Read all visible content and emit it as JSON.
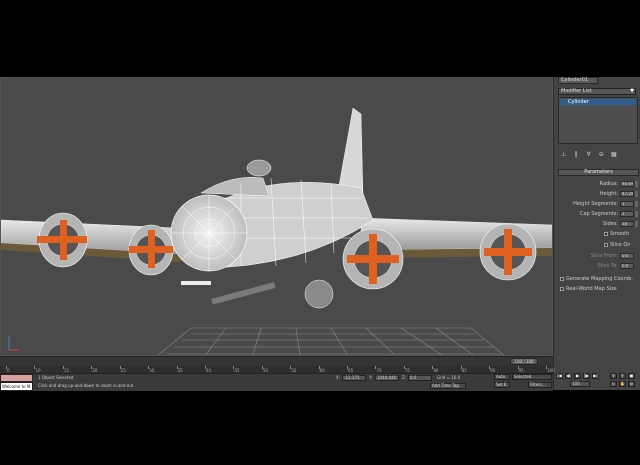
{
  "command_panel": {
    "object_name": "Cylinder01",
    "modifier_list": "Modifier List",
    "modifier_stack": [
      "Cylinder"
    ],
    "tool_icons": [
      "pin-stack-icon",
      "show-end-result-icon",
      "make-unique-icon",
      "remove-modifier-icon",
      "configure-sets-icon"
    ],
    "rollout_title": "Parameters",
    "params": [
      {
        "label": "Radius:",
        "value": "46.698"
      },
      {
        "label": "Height:",
        "value": "47.299"
      },
      {
        "label": "Height Segments:",
        "value": "1"
      },
      {
        "label": "Cap Segments:",
        "value": "1"
      },
      {
        "label": "Sides:",
        "value": "18"
      }
    ],
    "smooth_label": "Smooth",
    "slice_on_label": "Slice On",
    "slice_from_label": "Slice From:",
    "slice_from_value": "0.0",
    "slice_to_label": "Slice To:",
    "slice_to_value": "0.0",
    "gen_mapping_label": "Generate Mapping Coords.",
    "real_world_label": "Real-World Map Size"
  },
  "timeline": {
    "frame_counter": "100 / 100",
    "ruler_labels": [
      "0",
      "10",
      "15",
      "20",
      "25",
      "30",
      "35",
      "40",
      "45",
      "50",
      "55",
      "60",
      "65",
      "70",
      "75",
      "80",
      "85",
      "90",
      "95",
      "100"
    ]
  },
  "status": {
    "maxscript_label": "Welcome to M",
    "selection_text": "1 Object Selected",
    "prompt_text": "Click and drag up-and-down to zoom in and out",
    "x_label": "X:",
    "x_value": "-11.175",
    "y_label": "Y:",
    "y_value": "1040.440",
    "z_label": "Z:",
    "z_value": "0.0",
    "grid_text": "Grid = 10.0",
    "add_time_tag": "Add Time Tag",
    "auto_key": "Auto",
    "set_key": "Set K",
    "selected_dropdown": "Selected",
    "filters": "Filters...",
    "frame_value": "100",
    "playback_icons": [
      "go-start-icon",
      "prev-frame-icon",
      "play-icon",
      "next-frame-icon",
      "go-end-icon"
    ]
  },
  "colors": {
    "viewport_bg": "#4a4a4a",
    "wire": "#f2f2f2",
    "engine_orange": "#e06020",
    "selection_blue": "#2f5f8e"
  }
}
